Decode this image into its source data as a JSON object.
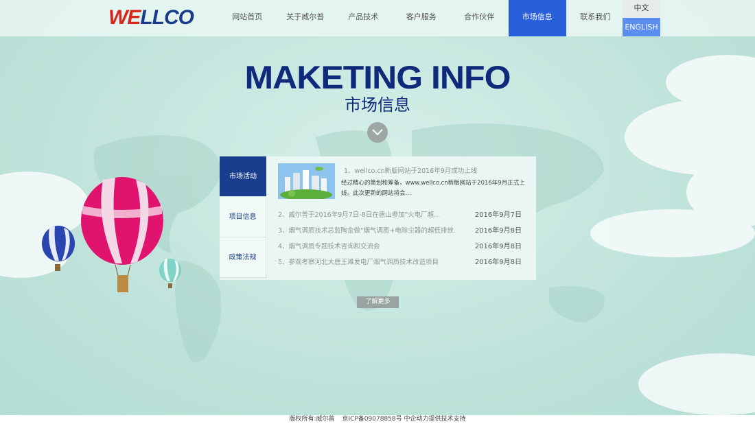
{
  "brand": {
    "logo_a": "WE",
    "logo_b": "LLCO"
  },
  "nav": {
    "items": [
      "网站首页",
      "关于威尔普",
      "产品技术",
      "客户服务",
      "合作伙伴",
      "市场信息",
      "联系我们"
    ],
    "active_index": 5
  },
  "lang": {
    "cn": "中文",
    "en": "ENGLISH"
  },
  "hero": {
    "title_en": "MAKETING INFO",
    "title_cn": "市场信息",
    "scroll_icon": "chevron-down-icon"
  },
  "panel": {
    "tabs": [
      "市场活动",
      "项目信息",
      "政策法规"
    ],
    "feature": {
      "title": "1、wellco.cn新版网站于2016年9月成功上线",
      "desc": "经过精心的策划和筹备，www.wellco.cn新版网站于2016年9月正式上线。此次更新的网站将会..."
    },
    "news": [
      {
        "title": "2、威尔普于2016年9月7日-8日在唐山参加\"火电厂超...",
        "date": "2016年9月7日"
      },
      {
        "title": "3、烟气调质技术总监陶金做\"烟气调质+电除尘器的超低排放...",
        "date": "2016年9月8日"
      },
      {
        "title": "4、烟气调质专题技术咨询和交流会",
        "date": "2016年9月8日"
      },
      {
        "title": "5、参观考察河北大唐王滩发电厂烟气调质技术改造项目",
        "date": "2016年9月8日"
      }
    ]
  },
  "more_label": "了解更多",
  "footer": {
    "copyright": "版权所有:威尔普",
    "icp": "京ICP备09078858号 中企动力提供技术支持"
  },
  "colors": {
    "navy": "#0f2a7a",
    "active_nav": "#2a5fdc",
    "english_btn": "#5b8ef0",
    "logo_red": "#d7261e"
  }
}
